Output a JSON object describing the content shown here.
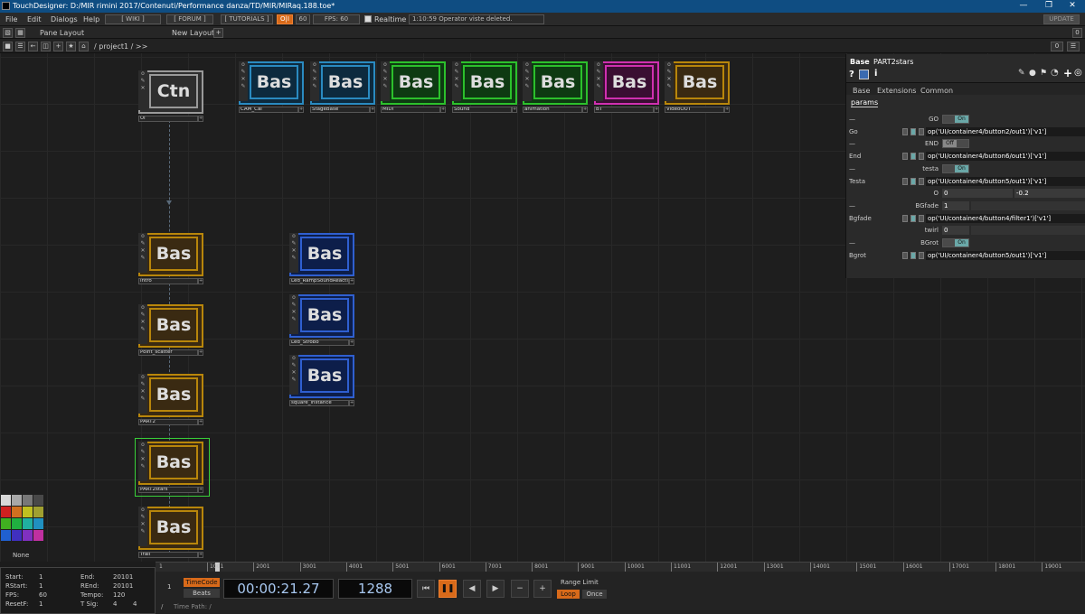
{
  "window": {
    "title": "TouchDesigner: D:/MIR rimini 2017/Contenuti/Performance danza/TD/MIR/MIRaq.188.toe*"
  },
  "menu": {
    "items": [
      "File",
      "Edit",
      "Dialogs",
      "Help"
    ],
    "wiki": "[ WIKI ]",
    "forum": "[ FORUM ]",
    "tutorials": "[ TUTORIALS ]",
    "oii": "O|I",
    "sixty": "60",
    "fps_label": "FPS:",
    "fps_value": "60",
    "realtime": "Realtime",
    "status": "1:10:59 Operator viste deleted.",
    "update": "UPDATE"
  },
  "pane": {
    "pane_layout": "Pane Layout",
    "new_layout": "New Layout",
    "plus": "+",
    "zero": "0"
  },
  "path": {
    "text": "/ project1 / >>",
    "zero": "0"
  },
  "nodes": {
    "ui": {
      "face": "Ctn",
      "label": "UI"
    },
    "cam_cal": {
      "face": "Bas",
      "label": "CAM_Cal"
    },
    "stagebase": {
      "face": "Bas",
      "label": "StageBase"
    },
    "midi": {
      "face": "Bas",
      "label": "MIDI"
    },
    "sound": {
      "face": "Bas",
      "label": "Sound"
    },
    "animation": {
      "face": "Bas",
      "label": "animation"
    },
    "bt": {
      "face": "Bas",
      "label": "BT"
    },
    "videoout": {
      "face": "Bas",
      "label": "VideoOUT"
    },
    "intro": {
      "face": "Bas",
      "label": "Intro"
    },
    "point_scatter": {
      "face": "Bas",
      "label": "Point_scatter"
    },
    "part2": {
      "face": "Bas",
      "label": "PART2"
    },
    "part2stars": {
      "face": "Bas",
      "label": "PART2stars"
    },
    "trail": {
      "face": "Bas",
      "label": "Trail"
    },
    "led_ramp": {
      "face": "Bas",
      "label": "Led_RampSoundReactive"
    },
    "led_strobo": {
      "face": "Bas",
      "label": "Led_Strobo"
    },
    "square_instance": {
      "face": "Bas",
      "label": "square_instance"
    }
  },
  "colors": {
    "orange": "#b8860b",
    "cyan": "#2a8ac0",
    "blue": "#2f5fd0",
    "green": "#2cc02c",
    "magenta": "#d030b0",
    "gray": "#9a9a9a",
    "selected": "#39d039"
  },
  "params": {
    "header_type": "Base",
    "header_name": "PART2stars",
    "tabs": [
      "Base",
      "Extensions",
      "Common"
    ],
    "subtab": "params",
    "rows": [
      {
        "left": "—",
        "name": "GO",
        "kind": "toggle",
        "value": "On"
      },
      {
        "left": "Go",
        "name": "",
        "kind": "expr",
        "value": "op('UI/container4/button2/out1')['v1']"
      },
      {
        "left": "—",
        "name": "END",
        "kind": "toggle_off",
        "value": "Off"
      },
      {
        "left": "End",
        "name": "",
        "kind": "expr",
        "value": "op('UI/container4/button6/out1')['v1']"
      },
      {
        "left": "—",
        "name": "testa",
        "kind": "toggle",
        "value": "On"
      },
      {
        "left": "Testa",
        "name": "",
        "kind": "expr",
        "value": "op('UI/container4/button5/out1')['v1']"
      },
      {
        "left": "",
        "name": "O",
        "kind": "pair",
        "value": "0",
        "value2": "-0.2"
      },
      {
        "left": "—",
        "name": "BGfade",
        "kind": "num",
        "value": "1"
      },
      {
        "left": "Bgfade",
        "name": "",
        "kind": "expr",
        "value": "op('UI/container4/button4/filter1')['v1']"
      },
      {
        "left": "",
        "name": "twirl",
        "kind": "num",
        "value": "0"
      },
      {
        "left": "—",
        "name": "BGrot",
        "kind": "toggle",
        "value": "On"
      },
      {
        "left": "Bgrot",
        "name": "",
        "kind": "expr",
        "value": "op('UI/container4/button5/out1')['v1']"
      }
    ]
  },
  "palette": {
    "none_label": "None",
    "swatches": [
      "#d8d8d8",
      "#a8a8a8",
      "#787878",
      "#484848",
      "#d02020",
      "#d07020",
      "#c0c020",
      "#a0a030",
      "#40b020",
      "#20b040",
      "#20b0a0",
      "#2090c0",
      "#2060d0",
      "#4030c0",
      "#8030c0",
      "#c030a0"
    ]
  },
  "timeline": {
    "first": "1",
    "ticks": [
      "1001",
      "2001",
      "3001",
      "4001",
      "5001",
      "6001",
      "7001",
      "8001",
      "9001",
      "10001",
      "11001",
      "12001",
      "13001",
      "14001",
      "15001",
      "16001",
      "17001",
      "18001",
      "19001"
    ]
  },
  "stats": {
    "start_label": "Start:",
    "start": "1",
    "end_label": "End:",
    "end": "20101",
    "rstart_label": "RStart:",
    "rstart": "1",
    "rend_label": "REnd:",
    "rend": "20101",
    "fps_label": "FPS:",
    "fps": "60",
    "tempo_label": "Tempo:",
    "tempo": "120",
    "resetf_label": "ResetF:",
    "resetf": "1",
    "tsig_label": "T Sig:",
    "tsig_a": "4",
    "tsig_b": "4"
  },
  "transport": {
    "one": "1",
    "timecode": "TimeCode",
    "beats": "Beats",
    "time": "00:00:21.27",
    "frame": "1288",
    "range_limit": "Range Limit",
    "loop": "Loop",
    "once": "Once",
    "time_path": "Time Path: /",
    "slash": "/"
  }
}
